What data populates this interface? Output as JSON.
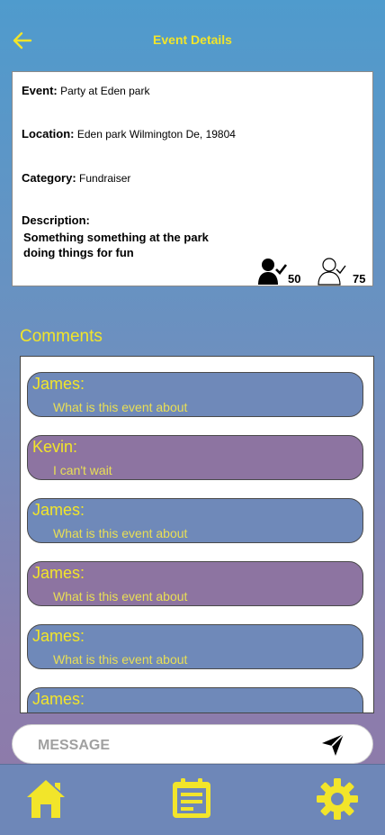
{
  "header": {
    "title": "Event Details",
    "back_icon": "arrow-left-icon"
  },
  "details": {
    "event_label": "Event:",
    "event_value": "Party at Eden park",
    "location_label": "Location:",
    "location_value": "Eden park Wilmington De, 19804",
    "category_label": "Category:",
    "category_value": "Fundraiser",
    "description_label": "Description:",
    "description_value": "Something something at the park doing things for fun",
    "attending_count": "50",
    "interested_count": "75"
  },
  "comments": {
    "label": "Comments",
    "items": [
      {
        "name": "James:",
        "text": "What is this event about"
      },
      {
        "name": "Kevin:",
        "text": "I can't wait"
      },
      {
        "name": "James:",
        "text": "What is this event about"
      },
      {
        "name": "James:",
        "text": "What is this event about"
      },
      {
        "name": "James:",
        "text": "What is this event about"
      },
      {
        "name": "James:",
        "text": ""
      }
    ]
  },
  "message": {
    "placeholder": "MESSAGE"
  },
  "colors": {
    "accent": "#f2e52a",
    "bubble_blue": "#6f89b9",
    "bubble_purple": "#8d74a1",
    "navbar": "#6e87b8"
  },
  "nav": {
    "items": [
      "home-icon",
      "calendar-icon",
      "settings-icon"
    ]
  }
}
